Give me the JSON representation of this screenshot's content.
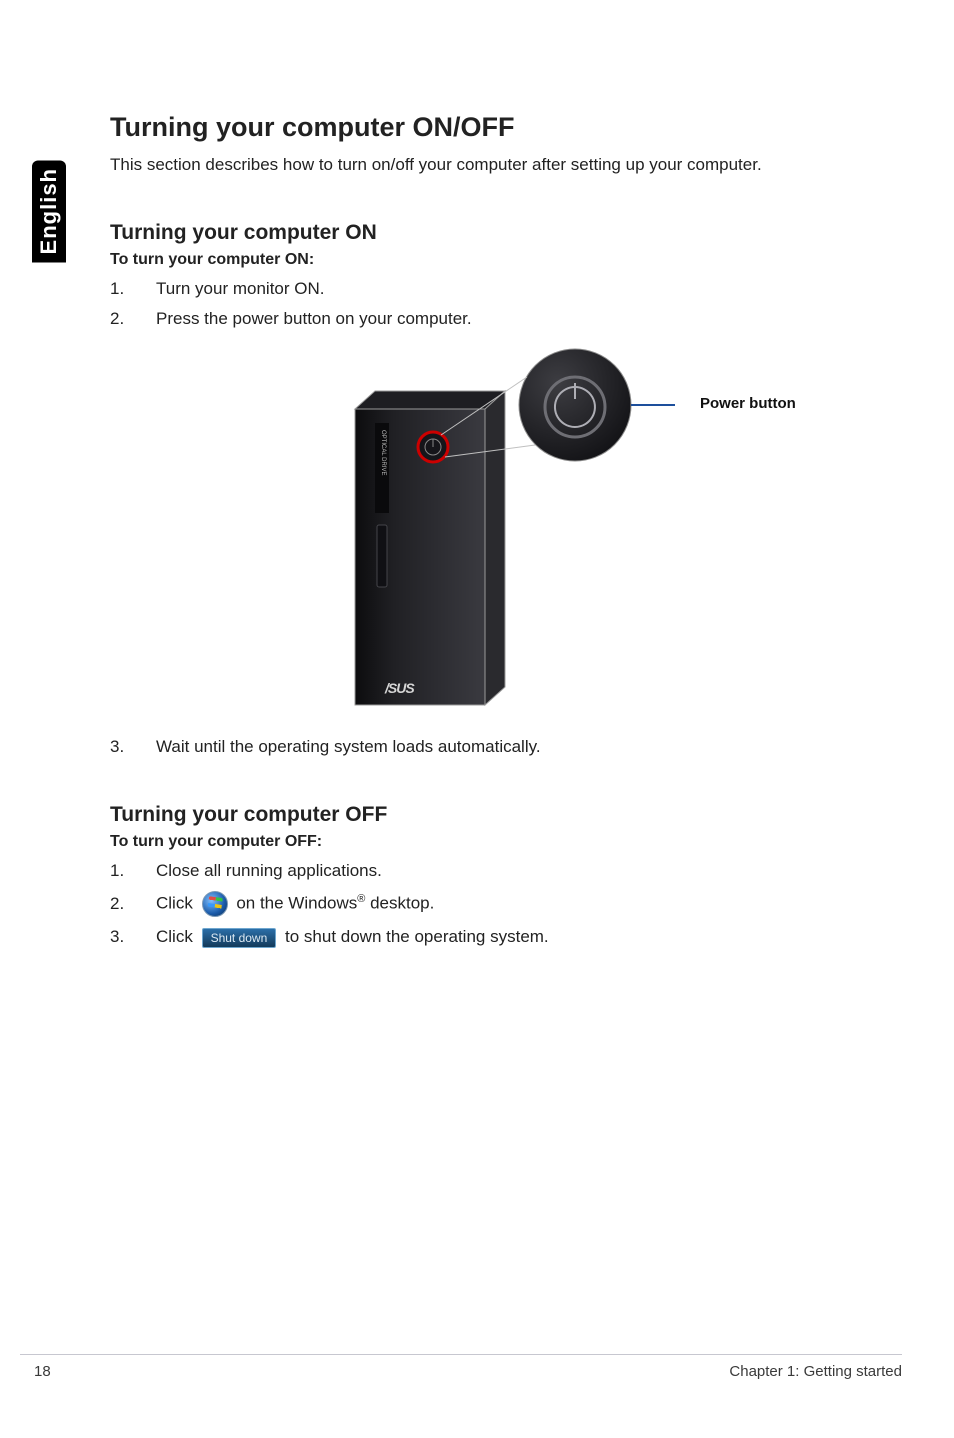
{
  "side_tab": "English",
  "h1": "Turning your computer ON/OFF",
  "intro": "This section describes how to turn on/off your computer after setting up your computer.",
  "section_on": {
    "h2": "Turning your computer ON",
    "subhead": "To turn your computer ON:",
    "steps": [
      "Turn your monitor ON.",
      "Press the power button on your computer."
    ],
    "step3": "Wait until the operating system loads automatically."
  },
  "illustration": {
    "callout_label": "Power button",
    "tower_text": "OPTICAL DRIVE",
    "logo_text": "/SUS"
  },
  "section_off": {
    "h2": "Turning your computer OFF",
    "subhead": "To turn your computer OFF:",
    "step1": "Close all running applications.",
    "step2_pre": "Click",
    "step2_post_a": " on the Windows",
    "step2_super": "®",
    "step2_post_b": " desktop.",
    "step3_pre": "Click ",
    "shutdown_label": "Shut down",
    "step3_post": " to shut down the operating system."
  },
  "footer": {
    "page_number": "18",
    "chapter": "Chapter 1: Getting started"
  }
}
